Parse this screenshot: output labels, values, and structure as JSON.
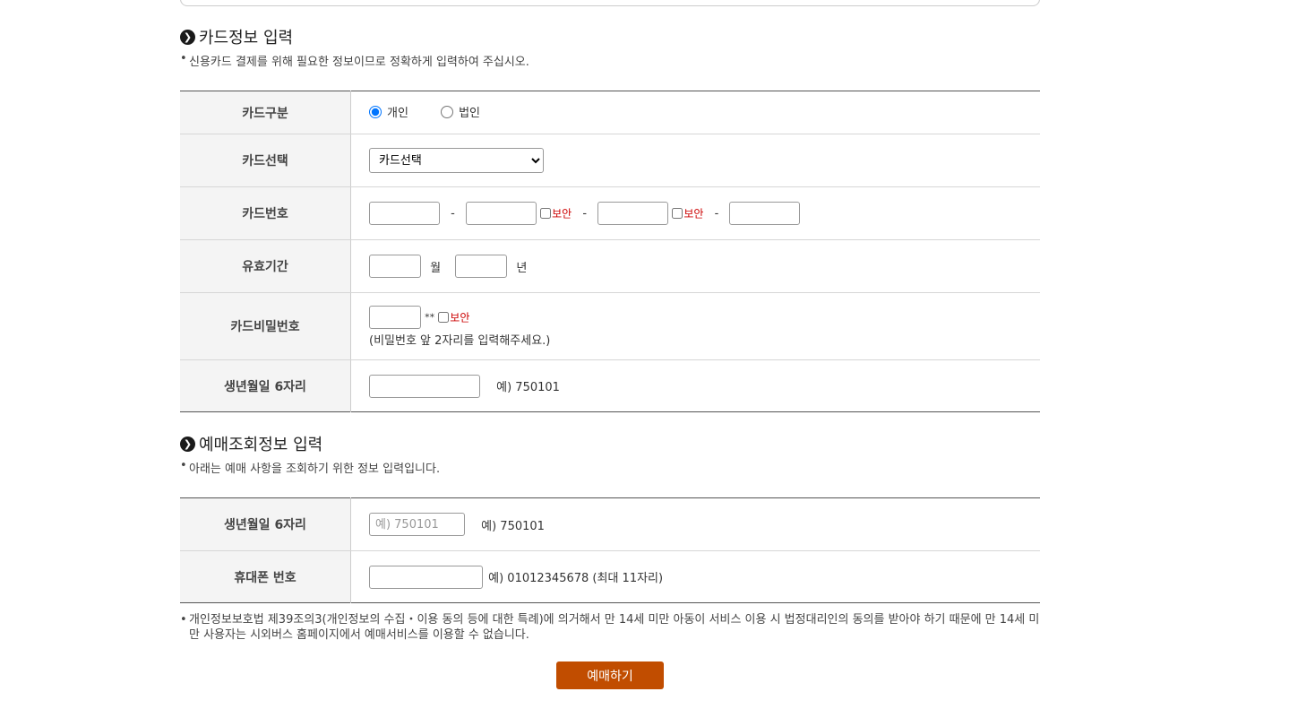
{
  "card_section": {
    "title": "카드정보 입력",
    "note": "신용카드 결제를 위해 필요한 정보이므로 정확하게 입력하여 주십시오.",
    "rows": {
      "type_label": "카드구분",
      "type_options": [
        "개인",
        "법인"
      ],
      "select_label": "카드선택",
      "select_value": "카드선택",
      "number_label": "카드번호",
      "secure_label": "보안",
      "dash": "-",
      "expiry_label": "유효기간",
      "month_unit": "월",
      "year_unit": "년",
      "pw_label": "카드비밀번호",
      "pw_mask": "**",
      "pw_hint": "(비밀번호 앞 2자리를 입력해주세요.)",
      "birth_label": "생년월일 6자리",
      "birth_example": "예) 750101"
    }
  },
  "booking_section": {
    "title": "예매조회정보 입력",
    "note": "아래는 예매 사항을 조회하기 위한 정보 입력입니다.",
    "rows": {
      "birth_label": "생년월일 6자리",
      "birth_placeholder": "예) 750101",
      "birth_example": "예) 750101",
      "phone_label": "휴대폰 번호",
      "phone_example": "예) 01012345678 (최대 11자리)"
    }
  },
  "legal_note": "개인정보보호법 제39조의3(개인정보의 수집・이용 동의 등에 대한 특례)에 의거해서 만 14세 미만 아동이 서비스 이용 시 법정대리인의 동의를 받아야 하기 때문에 만 14세 미만 사용자는 시외버스 홈페이지에서 예매서비스를 이용할 수 없습니다.",
  "submit_label": "예매하기",
  "bullet": "•",
  "colors": {
    "button": "#c14d00",
    "secure": "#cc0000"
  },
  "icons": {
    "section": "chevron-right-circle-icon"
  }
}
